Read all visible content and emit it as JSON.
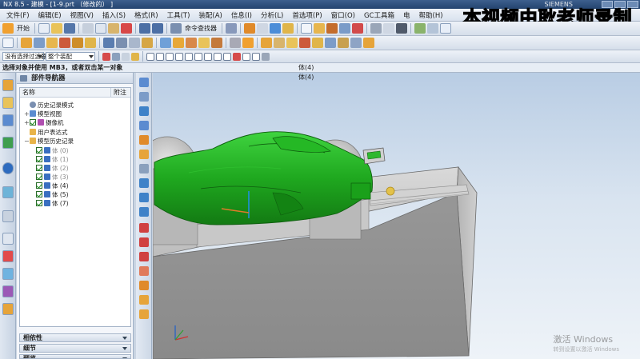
{
  "window": {
    "title": "NX 8.5 - 建模 - [1-9.prt （修改的） ]",
    "brand": "SIEMENS"
  },
  "overlay_caption": "本视频由耿老师录制",
  "menubar": {
    "items": [
      "文件(F)",
      "编辑(E)",
      "视图(V)",
      "插入(S)",
      "格式(R)",
      "工具(T)",
      "装配(A)",
      "信息(I)",
      "分析(L)",
      "首选项(P)",
      "窗口(O)",
      "GC工具箱",
      "电",
      "帮助(H)"
    ]
  },
  "toolbar1": {
    "start_label": "开始",
    "command_finder_label": "命令查找器"
  },
  "selection_bar": {
    "filter_value": "没有选择过滤器",
    "scope_value": "整个装配"
  },
  "cue_line": {
    "prompt": "选择对象并使用 MB3，或者双击某一对象",
    "status": "体(4)"
  },
  "navigator": {
    "title": "部件导航器",
    "columns": [
      "名称",
      "附注"
    ],
    "nodes": [
      {
        "label": "历史记录模式",
        "kind": "mode"
      },
      {
        "label": "模型视图",
        "kind": "views"
      },
      {
        "label": "摄像机",
        "kind": "camera"
      },
      {
        "label": "用户表达式",
        "kind": "expr"
      },
      {
        "label": "模型历史记录",
        "kind": "history"
      },
      {
        "label": "体 (0)",
        "kind": "body",
        "muted": true
      },
      {
        "label": "体 (1)",
        "kind": "body",
        "muted": true
      },
      {
        "label": "体 (2)",
        "kind": "body",
        "muted": true
      },
      {
        "label": "体 (3)",
        "kind": "body",
        "muted": true
      },
      {
        "label": "体 (4)",
        "kind": "body",
        "muted": false
      },
      {
        "label": "体 (5)",
        "kind": "body",
        "muted": false
      },
      {
        "label": "体 (7)",
        "kind": "body",
        "muted": false
      }
    ],
    "panels": [
      "相依性",
      "细节",
      "预览"
    ]
  },
  "watermark": {
    "line1": "激活 Windows",
    "line2": "转到设置以激活 Windows"
  },
  "colors": {
    "car_green": "#1fa81f",
    "block_grey": "#8e8e8e",
    "titlebar_blue": "#2f5283"
  }
}
